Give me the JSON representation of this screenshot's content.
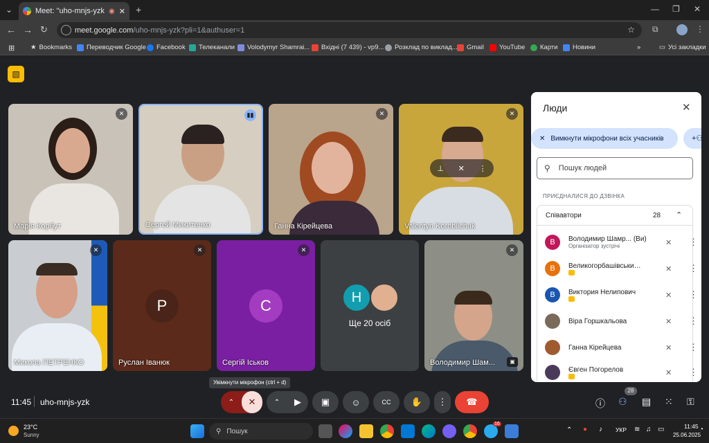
{
  "browser": {
    "tab_title": "Meet: \"uho-mnjs-yzk\"",
    "url_host": "meet.google.com",
    "url_path": "/uho-mnjs-yzk?pli=1&authuser=1",
    "bookmarks": [
      "Bookmarks",
      "Переводчик Google",
      "Facebook",
      "Телеканали",
      "Volodymyr Shamrai...",
      "Вхідні (7 439) - vp9...",
      "Розклад по виклад...",
      "Gmail",
      "YouTube",
      "Карти",
      "Новини"
    ],
    "other_bookmarks": "Усі закладки"
  },
  "tiles": [
    {
      "name": "Марія Корбут",
      "bg": "#c8c2b8",
      "skin": "#d9a98f",
      "hair": "#2b1d17",
      "shirt": "#e9e6e1"
    },
    {
      "name": "Сергей Микитенко",
      "bg": "#d6cfc1",
      "skin": "#caa084",
      "hair": "#2a2220",
      "shirt": "#e4e4e4"
    },
    {
      "name": "Ганна Кірейцева",
      "bg": "#b9a48c",
      "skin": "#e2b39d",
      "hair": "#a04a22",
      "shirt": "#3a2a3a"
    },
    {
      "name": "Valentyn Korobiichuk",
      "bg": "#c9a63c",
      "skin": "#d8aa8f",
      "hair": "#3b2a1e",
      "shirt": "#d8dde3"
    },
    {
      "name": "Микола ПЕТРЕНКО",
      "bg": "#c9cdd1",
      "skin": "#d79f87",
      "hair": "#3a2c22",
      "shirt": "#e8eef3"
    },
    {
      "name": "Руслан Іванюк",
      "letter": "Р",
      "bg": "#5c2a1a",
      "avatar_bg": "#4a2418"
    },
    {
      "name": "Сергій Іськов",
      "letter": "С",
      "bg": "#7b1fa2",
      "avatar_bg": "#a33cc0"
    },
    {
      "name": "Ще 20 осіб",
      "letter": "Н"
    },
    {
      "name": "Володимир Шам...",
      "bg": "#8d8f86",
      "skin": "#d4a58b",
      "hair": "#3a2a1c",
      "shirt": "#4a5a6a"
    }
  ],
  "panel": {
    "title": "Люди",
    "mute_all": "Вимкнути мікрофони всіх учасників",
    "search_placeholder": "Пошук людей",
    "section": "ПРИЄДНАЛИСЯ ДО ДЗВІНКА",
    "group_label": "Співавтори",
    "group_count": "28",
    "people": [
      {
        "initial": "В",
        "name": "Володимир Шамр...",
        "tag": "(Ви)",
        "sub": "Організатор зустрічі",
        "color": "#c2185b"
      },
      {
        "initial": "В",
        "name": "Великогорбашівський ...",
        "tag": "",
        "sub": "",
        "color": "#e8710a"
      },
      {
        "initial": "В",
        "name": "Виктория Нелипович",
        "tag": "",
        "sub": "",
        "color": "#1a56b0"
      },
      {
        "initial": "",
        "name": "Віра Горшкальова",
        "tag": "",
        "sub": "",
        "color": "#7a6a5a"
      },
      {
        "initial": "",
        "name": "Ганна Кірейцева",
        "tag": "",
        "sub": "",
        "color": "#a05a30"
      },
      {
        "initial": "",
        "name": "Євген Погорелов",
        "tag": "",
        "sub": "",
        "color": "#4a3a5a"
      }
    ]
  },
  "bottom": {
    "time": "11:45",
    "meeting_code": "uho-mnjs-yzk",
    "tooltip": "Увімкнути мікрофон (ctrl + d)",
    "people_badge": "28"
  },
  "taskbar": {
    "temp": "23°C",
    "weather": "Sunny",
    "search": "Пошук",
    "lang": "УКР",
    "time": "11:45",
    "date": "25.06.2025",
    "telegram_badge": "16"
  },
  "colors": {
    "accent": "#8ab4f8",
    "end_call": "#ea4335",
    "mic_muted": "#f9dedc"
  }
}
